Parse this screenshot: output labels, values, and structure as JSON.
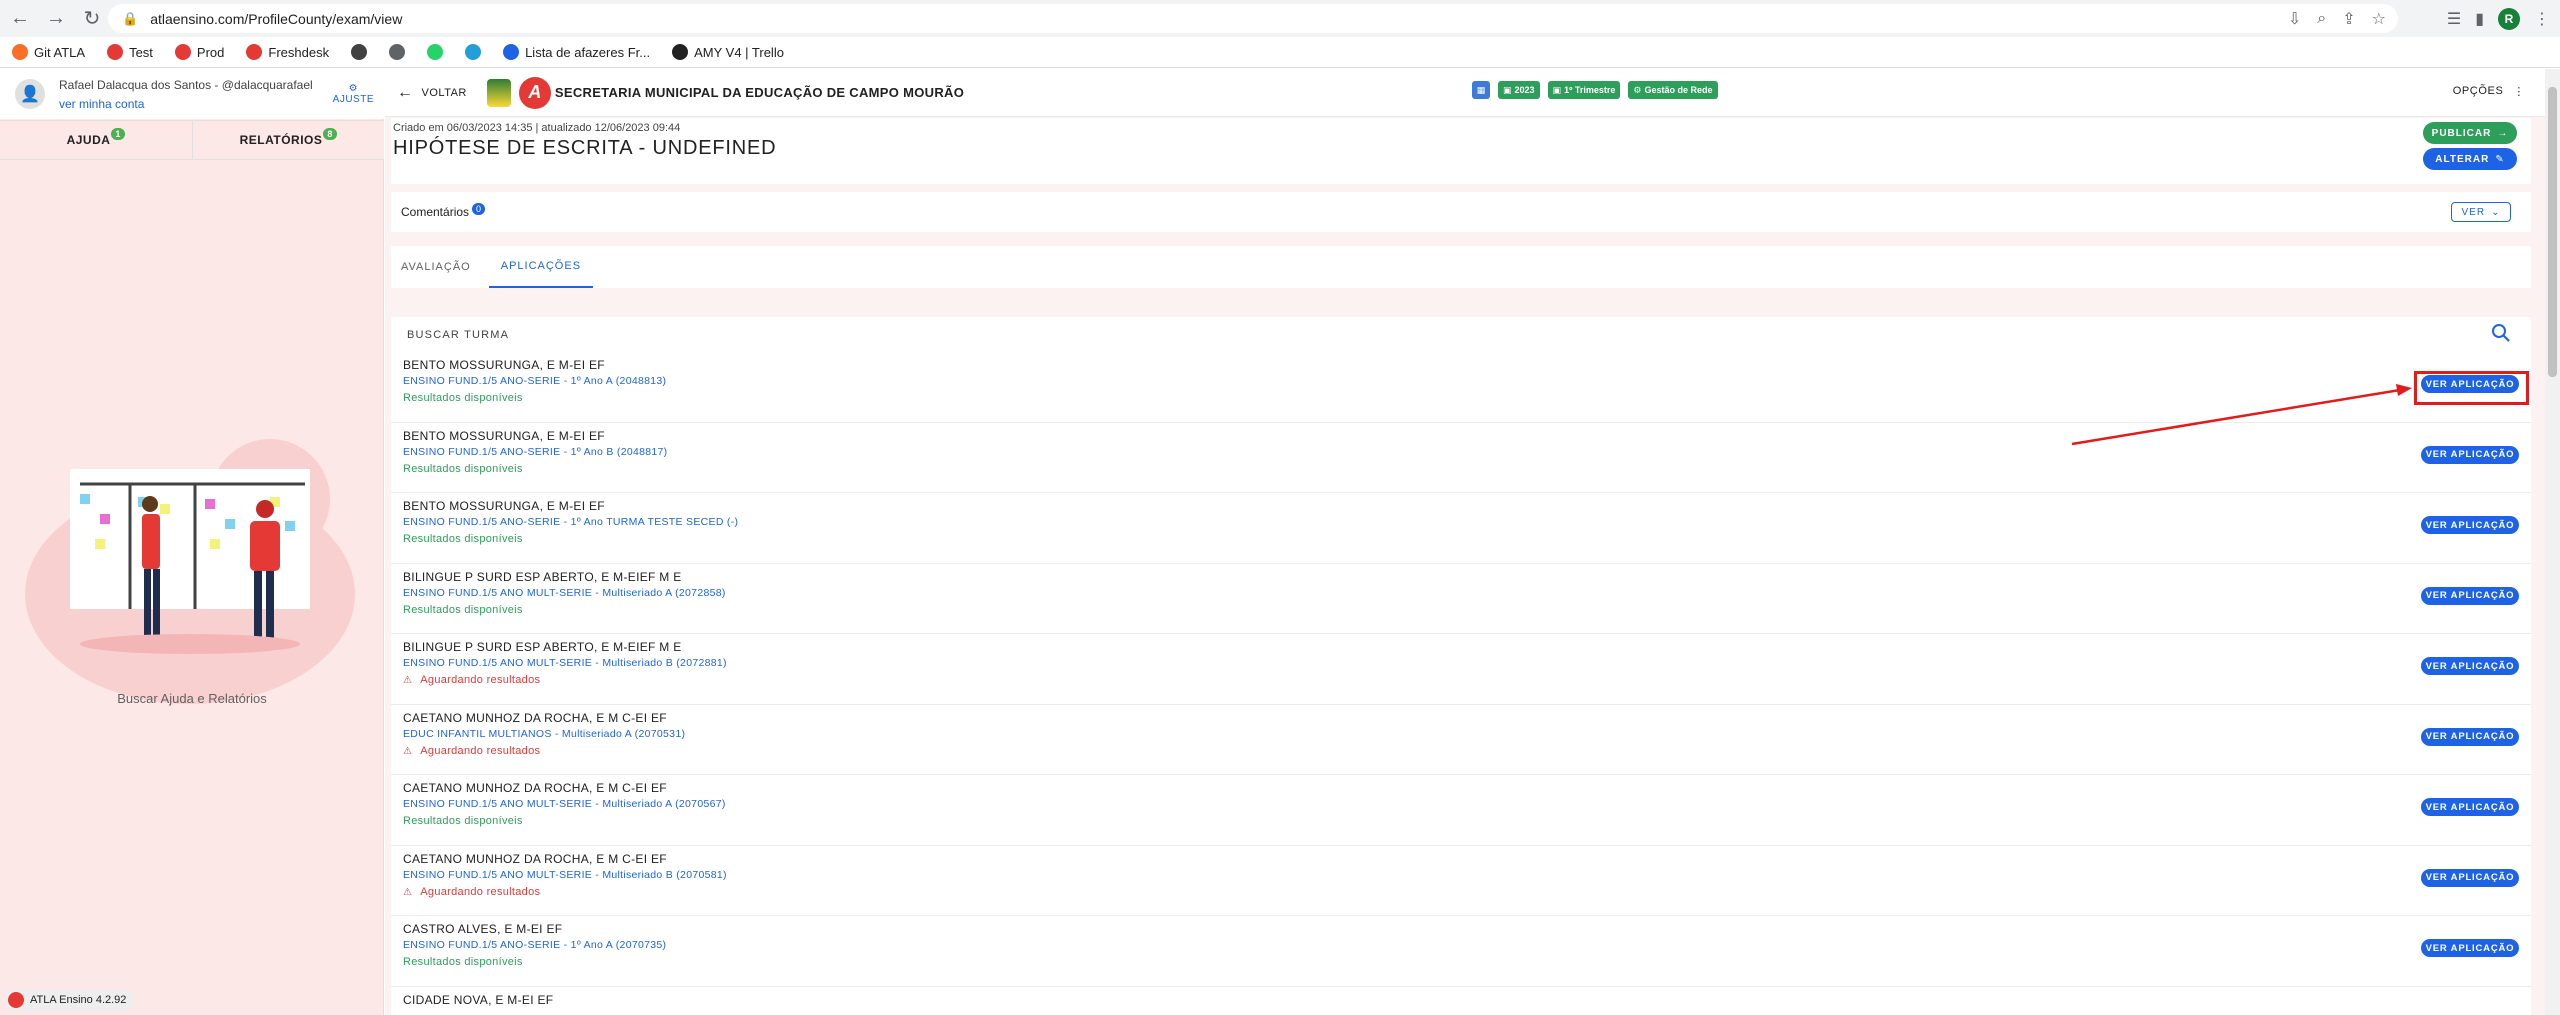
{
  "browser": {
    "url": "atlaensino.com/ProfileCounty/exam/view",
    "profile_initial": "R",
    "bookmarks": [
      {
        "label": "Git ATLA",
        "color": "#fc6d26"
      },
      {
        "label": "Test",
        "color": "#e53935"
      },
      {
        "label": "Prod",
        "color": "#e53935"
      },
      {
        "label": "Freshdesk",
        "color": "#e53935"
      },
      {
        "label": "",
        "color": "#424242"
      },
      {
        "label": "",
        "color": "#5f6368"
      },
      {
        "label": "",
        "color": "#25d366"
      },
      {
        "label": "",
        "color": "#229ed9"
      },
      {
        "label": "Lista de afazeres Fr...",
        "color": "#1e63e6"
      },
      {
        "label": "AMY V4 | Trello",
        "color": "#212121"
      }
    ]
  },
  "sidebar": {
    "user_name": "Rafael Dalacqua dos Santos - @dalacquarafael",
    "user_link": "ver minha conta",
    "ajuste": "AJUSTE",
    "tabs": [
      {
        "label": "AJUDA",
        "badge": "1"
      },
      {
        "label": "RELATÓRIOS",
        "badge": "8"
      }
    ],
    "help_text": "Buscar Ajuda e Relatórios",
    "version": "ATLA Ensino 4.2.92"
  },
  "topbar": {
    "back_label": "VOLTAR",
    "org_title": "SECRETARIA MUNICIPAL DA EDUCAÇÃO DE CAMPO MOURÃO",
    "chips": [
      "2023",
      "1º Trimestre",
      "Gestão de Rede"
    ],
    "options_label": "OPÇÕES"
  },
  "exam": {
    "meta": "Criado em 06/03/2023 14:35 | atualizado 12/06/2023 09:44",
    "title": "HIPÓTESE DE ESCRITA - UNDEFINED",
    "publish_label": "PUBLICAR",
    "edit_label": "ALTERAR"
  },
  "comments": {
    "label": "Comentários",
    "count": "0",
    "view_label": "VER"
  },
  "tabs": [
    {
      "label": "AVALIAÇÃO",
      "active": false
    },
    {
      "label": "APLICAÇÕES",
      "active": true
    }
  ],
  "list": {
    "search_label": "BUSCAR TURMA",
    "button_label": "VER APLICAÇÃO",
    "rows": [
      {
        "school": "BENTO MOSSURUNGA, E M-EI EF",
        "class": "ENSINO FUND.1/5 ANO-SERIE - 1º Ano A (2048813)",
        "status": "Resultados disponíveis",
        "status_type": "ok"
      },
      {
        "school": "BENTO MOSSURUNGA, E M-EI EF",
        "class": "ENSINO FUND.1/5 ANO-SERIE - 1º Ano B (2048817)",
        "status": "Resultados disponíveis",
        "status_type": "ok"
      },
      {
        "school": "BENTO MOSSURUNGA, E M-EI EF",
        "class": "ENSINO FUND.1/5 ANO-SERIE - 1º Ano TURMA TESTE SECED (-)",
        "status": "Resultados disponíveis",
        "status_type": "ok"
      },
      {
        "school": "BILINGUE P SURD ESP ABERTO, E M-EIEF M E",
        "class": "ENSINO FUND.1/5 ANO MULT-SERIE - Multiseriado A (2072858)",
        "status": "Resultados disponíveis",
        "status_type": "ok"
      },
      {
        "school": "BILINGUE P SURD ESP ABERTO, E M-EIEF M E",
        "class": "ENSINO FUND.1/5 ANO MULT-SERIE - Multiseriado B (2072881)",
        "status": "Aguardando resultados",
        "status_type": "wait"
      },
      {
        "school": "CAETANO MUNHOZ DA ROCHA, E M C-EI EF",
        "class": "EDUC INFANTIL MULTIANOS - Multiseriado A (2070531)",
        "status": "Aguardando resultados",
        "status_type": "wait"
      },
      {
        "school": "CAETANO MUNHOZ DA ROCHA, E M C-EI EF",
        "class": "ENSINO FUND.1/5 ANO MULT-SERIE - Multiseriado A (2070567)",
        "status": "Resultados disponíveis",
        "status_type": "ok"
      },
      {
        "school": "CAETANO MUNHOZ DA ROCHA, E M C-EI EF",
        "class": "ENSINO FUND.1/5 ANO MULT-SERIE - Multiseriado B (2070581)",
        "status": "Aguardando resultados",
        "status_type": "wait"
      },
      {
        "school": "CASTRO ALVES, E M-EI EF",
        "class": "ENSINO FUND.1/5 ANO-SERIE - 1º Ano A (2070735)",
        "status": "Resultados disponíveis",
        "status_type": "ok"
      },
      {
        "school": "CIDADE NOVA, E M-EI EF",
        "class": "",
        "status": "",
        "status_type": "ok"
      }
    ]
  },
  "colors": {
    "accent": "#1e63e6",
    "success": "#2e9e5b",
    "danger": "#e53935",
    "annotation": "#e21b1b"
  }
}
